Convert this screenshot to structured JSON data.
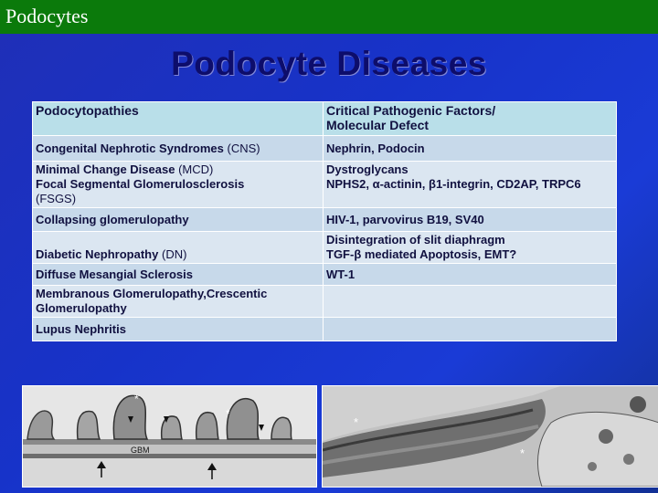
{
  "header": {
    "title": "Podocytes"
  },
  "slide": {
    "title": "Podocyte Diseases",
    "table": {
      "headers": [
        "Podocytopathies",
        "Critical Pathogenic Factors/\nMolecular Defect"
      ],
      "rows": [
        {
          "disease": "Congenital Nephrotic Syndromes",
          "abbr": "(CNS)",
          "factors": "Nephrin, Podocin"
        },
        {
          "disease": "Minimal Change Disease",
          "abbr": "(MCD)",
          "disease2": "Focal Segmental Glomerulosclerosis",
          "abbr2": "(FSGS)",
          "factors": "Dystroglycans",
          "factors2": "NPHS2, α-actinin, β1-integrin, CD2AP, TRPC6"
        },
        {
          "disease": "Collapsing glomerulopathy",
          "abbr": "",
          "factors": "HIV-1, parvovirus B19, SV40"
        },
        {
          "disease": "Diabetic Nephropathy",
          "abbr": "(DN)",
          "factors": "Disintegration of slit diaphragm",
          "factors2": "TGF-β mediated Apoptosis, EMT?"
        },
        {
          "disease": "Diffuse Mesangial Sclerosis",
          "abbr": "",
          "factors": "WT-1"
        },
        {
          "disease": "Membranous Glomerulopathy,Crescentic Glomerulopathy",
          "abbr": "",
          "factors": ""
        },
        {
          "disease": "Lupus Nephritis",
          "abbr": "",
          "factors": ""
        }
      ]
    },
    "micrographs": {
      "left_label": "GBM"
    }
  }
}
